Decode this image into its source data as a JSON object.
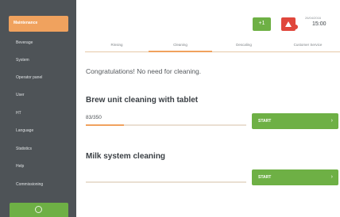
{
  "sidebar": {
    "items": [
      {
        "label": "Maintenance",
        "active": true
      },
      {
        "label": "Beverage"
      },
      {
        "label": "System"
      },
      {
        "label": "Operator panel"
      },
      {
        "label": "User"
      },
      {
        "label": "HT"
      },
      {
        "label": "Language"
      },
      {
        "label": "Statistics"
      },
      {
        "label": "Help"
      },
      {
        "label": "Commissioning"
      }
    ],
    "bottom_icon": "power-icon"
  },
  "header": {
    "green_button_label": "+1",
    "alert_icon": "warning-icon",
    "date": "26/04/2016",
    "time": "15:00"
  },
  "tabs": [
    {
      "label": "Rinsing",
      "active": false
    },
    {
      "label": "Cleaning",
      "active": true
    },
    {
      "label": "Descaling",
      "active": false
    },
    {
      "label": "Customer Service",
      "active": false
    }
  ],
  "main": {
    "message": "Congratulations! No need for cleaning.",
    "brew": {
      "title": "Brew unit cleaning with tablet",
      "counter": "83/350",
      "progress": 0.237,
      "start_label": "START"
    },
    "milk": {
      "title": "Milk system cleaning",
      "progress": 0,
      "start_label": "START"
    }
  },
  "colors": {
    "sidebar_bg": "#4e5357",
    "accent": "#f0a25e",
    "green": "#6eb045",
    "red": "#e0473c"
  }
}
